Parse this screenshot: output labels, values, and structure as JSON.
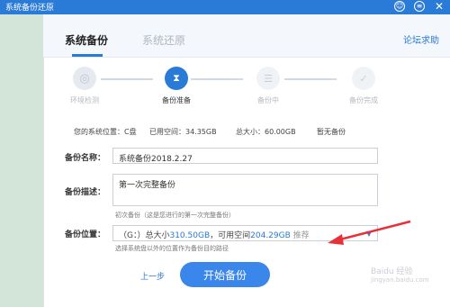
{
  "window": {
    "title": "系统备份还原",
    "icon_names": [
      "smile-icon",
      "menu-icon",
      "close-icon"
    ]
  },
  "tabs": [
    {
      "label": "系统备份",
      "active": true
    },
    {
      "label": "系统还原",
      "active": false
    }
  ],
  "forum_link": "论坛求助",
  "steps": [
    {
      "label": "环境检测",
      "state": "done",
      "icon": "search-icon"
    },
    {
      "label": "备份准备",
      "state": "active",
      "icon": "hourglass-icon"
    },
    {
      "label": "备份中",
      "state": "pending",
      "icon": "stack-icon"
    },
    {
      "label": "备份完成",
      "state": "pending",
      "icon": "check-icon"
    }
  ],
  "info": {
    "location": "您的系统位置：C盘",
    "used": "已用空间：34.35GB",
    "total": "总大小：60.00GB",
    "backup_status": "暂无备份"
  },
  "form": {
    "name_label": "备份名称：",
    "name_value": "系统备份2018.2.27",
    "desc_label": "备份描述：",
    "desc_value": "第一次完整备份",
    "desc_hint": "初次备份（这是您进行的第一次完整备份）",
    "location_label": "备份位置：",
    "location_prefix": "（G：）总大小",
    "location_total": "310.50GB",
    "location_mid": "，可用空间",
    "location_free": "204.29GB",
    "location_tag": "推荐",
    "location_hint": "选择系统盘以外的位置作为备份目的路径"
  },
  "buttons": {
    "prev": "上一步",
    "start": "开始备份"
  },
  "watermark": {
    "line1": "Baidu 经验",
    "line2": "jingyan.baidu.com"
  },
  "colors": {
    "accent": "#2a7ad8",
    "button": "#3b86ea",
    "annotation_arrow": "#e8303a"
  }
}
